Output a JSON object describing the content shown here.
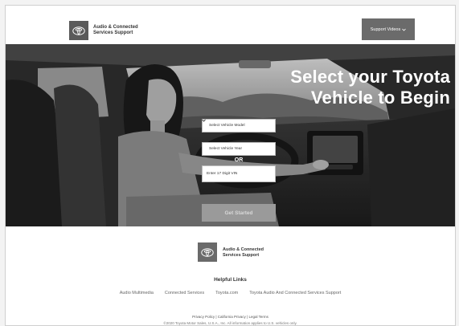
{
  "header": {
    "brand_line1": "Audio & Connected",
    "brand_line2": "Services Support",
    "videos_label": "Support Videos",
    "videos_icon": "chevron-down-icon"
  },
  "hero": {
    "title_line1": "Select your Toyota",
    "title_line2": "Vehicle to Begin",
    "model_select": "Select Vehicle Model",
    "year_select": "Select Vehicle Year",
    "or_text": "OR",
    "vin_placeholder": "Enter 17 Digit VIN",
    "start_button": "Get Started"
  },
  "footer": {
    "brand_line1": "Audio & Connected",
    "brand_line2": "Services Support",
    "helpful_title": "Helpful Links",
    "links": [
      "Audio Multimedia",
      "Connected Services",
      "Toyota.com",
      "Toyota Audio And Connected Services Support"
    ],
    "legal": "Privacy Policy | California Privacy | Legal Terms",
    "copyright": "©2020 Toyota Motor Sales, U.S.A., Inc. All information applies to U.S. vehicles only."
  },
  "colors": {
    "header_button": "#6b6b6b",
    "hero_background": "#2c2c2c",
    "start_button": "#9a9a9a"
  }
}
